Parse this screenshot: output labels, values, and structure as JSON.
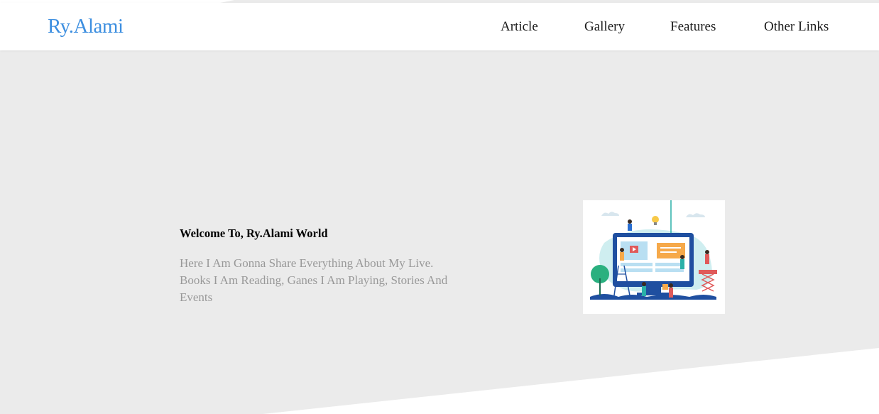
{
  "brand": {
    "name": "Ry.Alami",
    "color": "#3d8fe0"
  },
  "nav": {
    "items": [
      {
        "label": "Article"
      },
      {
        "label": "Gallery"
      },
      {
        "label": "Features"
      },
      {
        "label": "Other Links"
      }
    ]
  },
  "hero": {
    "title": "Welcome To, Ry.Alami World",
    "description": "Here I Am Gonna Share Everything About My Live. Books I Am Reading, Ganes I Am Playing, Stories And Events",
    "illustration": "web-building-illustration"
  },
  "colors": {
    "hero_background": "#ebebeb",
    "page_background": "#ffffff",
    "muted_text": "#999999"
  }
}
